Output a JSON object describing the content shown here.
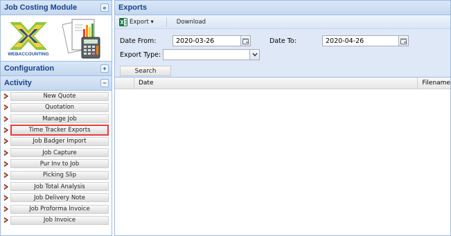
{
  "left_panel": {
    "title": "Job Costing Module",
    "collapse_glyph": "«",
    "logo_text": "WEBACCOUNTING",
    "sections": {
      "configuration": {
        "label": "Configuration",
        "toggle": "+"
      },
      "activity": {
        "label": "Activity",
        "toggle": "−"
      }
    },
    "menu": [
      {
        "label": "New Quote"
      },
      {
        "label": "Quotation"
      },
      {
        "label": "Manage Job"
      },
      {
        "label": "Time Tracker Exports"
      },
      {
        "label": "Job Badger Import"
      },
      {
        "label": "Job Capture"
      },
      {
        "label": "Pur Inv to Job"
      },
      {
        "label": "Picking Slip"
      },
      {
        "label": "Job Total Analysis"
      },
      {
        "label": "Job Delivery Note"
      },
      {
        "label": "Job Proforma Invoice"
      },
      {
        "label": "Job Invoice"
      }
    ],
    "highlighted_item": "Time Tracker Exports"
  },
  "main": {
    "title": "Exports",
    "toolbar": {
      "export_label": "Export ▾",
      "download_label": "Download"
    },
    "form": {
      "date_from_label": "Date From:",
      "date_from_value": "2020-03-26",
      "date_to_label": "Date To:",
      "date_to_value": "2020-04-26",
      "export_type_label": "Export Type:",
      "export_type_value": "",
      "search_label": "Search"
    },
    "grid": {
      "columns": [
        "",
        "Date",
        "Filename"
      ]
    }
  },
  "colors": {
    "header_text": "#15428b",
    "panel_border": "#99bbe8",
    "form_background": "#dfe8f6",
    "highlight_border": "#e23c3c"
  }
}
